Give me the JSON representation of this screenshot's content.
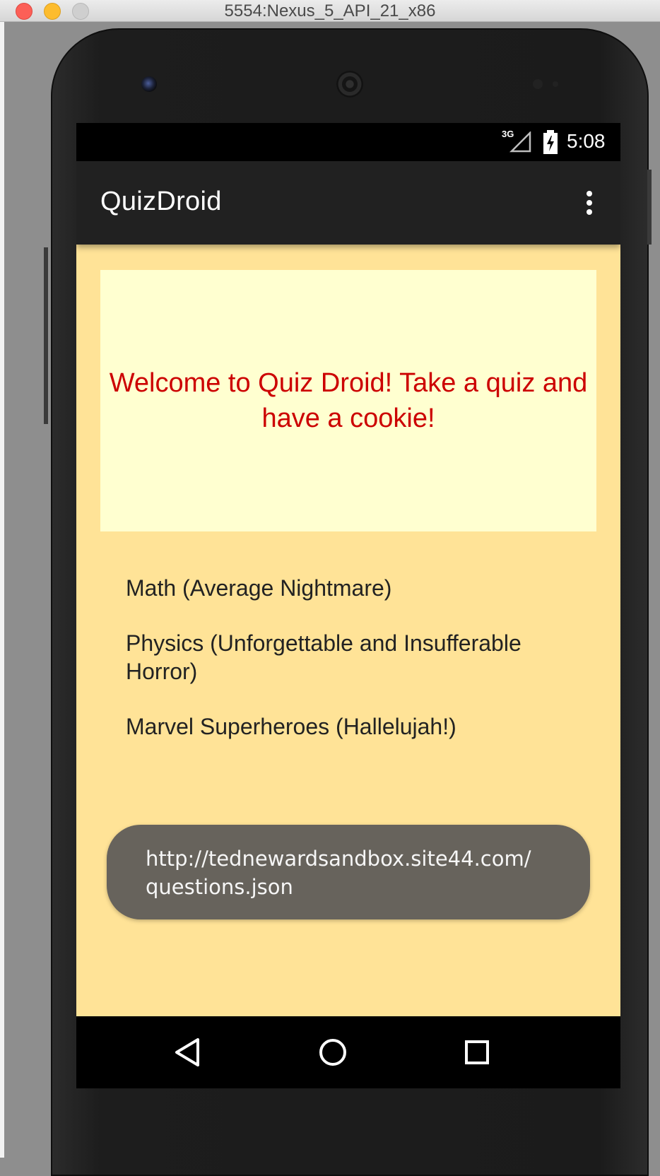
{
  "window": {
    "title": "5554:Nexus_5_API_21_x86"
  },
  "status_bar": {
    "network_label": "3G",
    "time": "5:08"
  },
  "app_bar": {
    "title": "QuizDroid",
    "overflow_icon": "more-vert-icon"
  },
  "welcome": {
    "text": "Welcome to Quiz Droid! Take a quiz and have a cookie!",
    "text_color": "#cc0000",
    "background": "#ffffd0"
  },
  "quizzes": [
    {
      "label": "Math (Average Nightmare)"
    },
    {
      "label": "Physics (Unforgettable and Insufferable Horror)"
    },
    {
      "label": "Marvel Superheroes (Hallelujah!)"
    }
  ],
  "toast": {
    "text": "http://tednewardsandbox.site44.com/questions.json"
  },
  "nav_bar": {
    "back_icon": "back-triangle-icon",
    "home_icon": "home-circle-icon",
    "recents_icon": "recents-square-icon"
  },
  "colors": {
    "screen_background": "#ffe397",
    "app_bar": "#212121",
    "toast": "#67635c"
  }
}
